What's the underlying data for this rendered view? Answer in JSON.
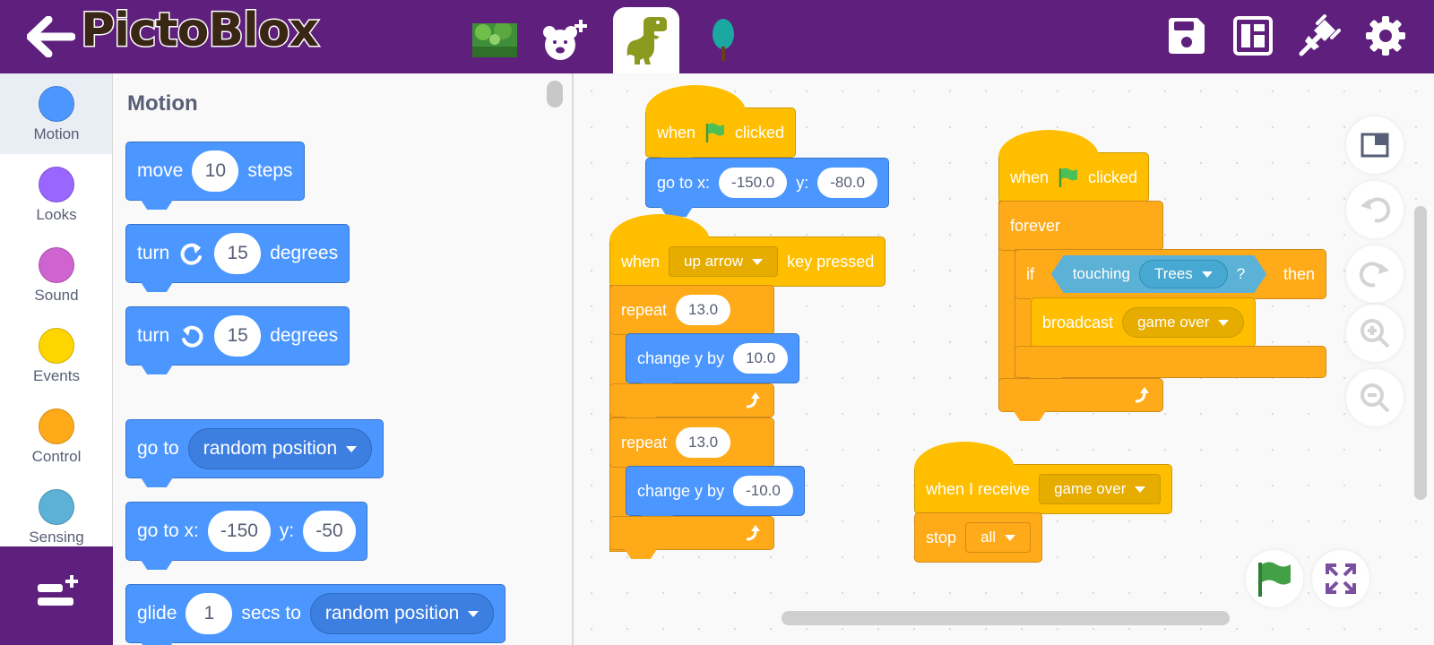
{
  "app": {
    "title": "PictoBlox"
  },
  "topbar": {
    "tabs": [
      {
        "name": "backdrop-stage",
        "icon": "backdrop-thumbnail-icon"
      },
      {
        "name": "add-sprite",
        "icon": "bear-add-icon"
      },
      {
        "name": "sprite-dino",
        "icon": "dino-sprite-icon",
        "active": true
      },
      {
        "name": "sprite-tree",
        "icon": "tree-sprite-icon"
      }
    ],
    "actions": [
      "save-icon",
      "dashboard-icon",
      "connect-plug-icon",
      "settings-gear-icon"
    ]
  },
  "categories": [
    {
      "label": "Motion",
      "color": "#4c97ff",
      "active": true
    },
    {
      "label": "Looks",
      "color": "#9966ff"
    },
    {
      "label": "Sound",
      "color": "#cf63cf"
    },
    {
      "label": "Events",
      "color": "#ffd500"
    },
    {
      "label": "Control",
      "color": "#ffab19"
    },
    {
      "label": "Sensing",
      "color": "#5cb1d6"
    }
  ],
  "palette": {
    "title": "Motion",
    "blocks": {
      "move": {
        "pre": "move",
        "value": "10",
        "post": "steps"
      },
      "turn_right": {
        "pre": "turn",
        "value": "15",
        "post": "degrees"
      },
      "turn_left": {
        "pre": "turn",
        "value": "15",
        "post": "degrees"
      },
      "goto": {
        "pre": "go to",
        "option": "random position"
      },
      "gotoxy": {
        "pre": "go to x:",
        "x": "-150",
        "ylabel": "y:",
        "y": "-50"
      },
      "glide": {
        "pre": "glide",
        "value": "1",
        "mid": "secs to",
        "option": "random position"
      }
    }
  },
  "workspace": {
    "script1": {
      "hat": {
        "pre": "when",
        "post": "clicked"
      },
      "goto": {
        "pre": "go to x:",
        "x": "-150.0",
        "ylabel": "y:",
        "y": "-80.0"
      }
    },
    "script2": {
      "hat": {
        "pre": "when",
        "key": "up arrow",
        "post": "key pressed"
      },
      "repeat1": {
        "label": "repeat",
        "count": "13.0"
      },
      "change1": {
        "label": "change y by",
        "value": "10.0"
      },
      "repeat2": {
        "label": "repeat",
        "count": "13.0"
      },
      "change2": {
        "label": "change y by",
        "value": "-10.0"
      }
    },
    "script3": {
      "hat": {
        "pre": "when",
        "post": "clicked"
      },
      "forever": "forever",
      "if": {
        "label": "if",
        "then": "then"
      },
      "touching": {
        "label": "touching",
        "target": "Trees",
        "q": "?"
      },
      "broadcast": {
        "label": "broadcast",
        "message": "game over"
      }
    },
    "script4": {
      "hat": {
        "label": "when I receive",
        "message": "game over"
      },
      "stop": {
        "label": "stop",
        "option": "all"
      }
    }
  },
  "colors": {
    "brand": "#5e1f7d",
    "motion": "#4c97ff",
    "events": "#ffbf00",
    "control": "#ffab19",
    "sensing": "#5cb1d6",
    "green_flag": "#4caf50"
  }
}
